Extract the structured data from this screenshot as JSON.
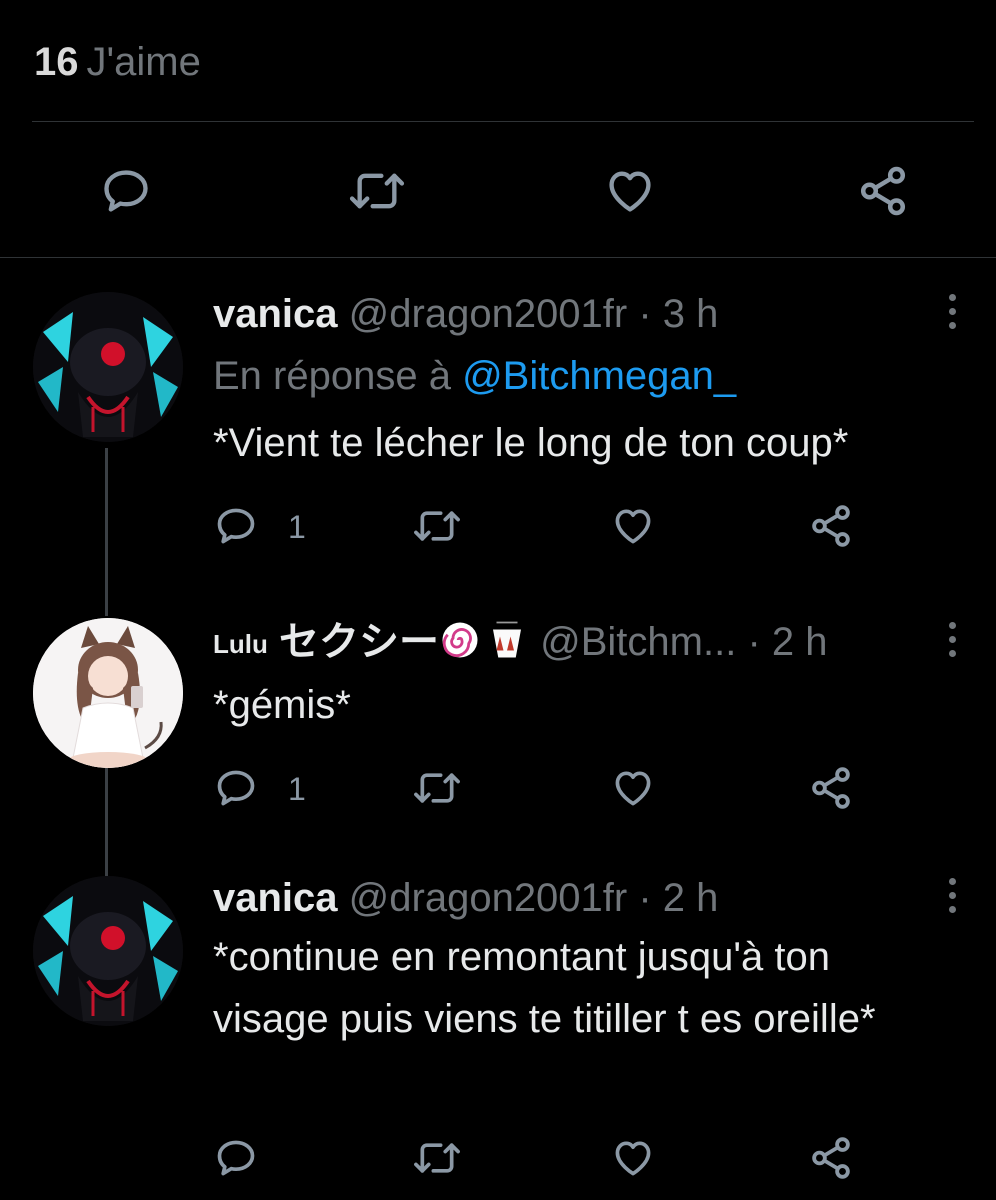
{
  "likes": {
    "count": "16",
    "label": "J'aime"
  },
  "tweets": [
    {
      "display_name": "vanica",
      "handle": "@dragon2001fr",
      "time": "· 3 h",
      "reply_prefix": "En réponse à",
      "reply_mention": "@Bitchmegan_",
      "text": "*Vient te lécher le long de ton coup*",
      "replies": "1"
    },
    {
      "display_name": "Lulu",
      "display_name_rest": "セクシー",
      "emojis": [
        "spiral-emoji",
        "takeout-box-emoji"
      ],
      "handle": "@Bitchm...",
      "time": "· 2 h",
      "text": "*gémis*",
      "replies": "1"
    },
    {
      "display_name": "vanica",
      "handle": "@dragon2001fr",
      "time": "· 2 h",
      "text": "*continue en remontant jusqu'à ton visage puis viens te titiller t es oreille*",
      "replies": ""
    }
  ],
  "colors": {
    "background": "#000000",
    "text": "#e7e9ea",
    "muted": "#71767b",
    "link": "#1d9bf0",
    "divider": "#2f3336"
  }
}
